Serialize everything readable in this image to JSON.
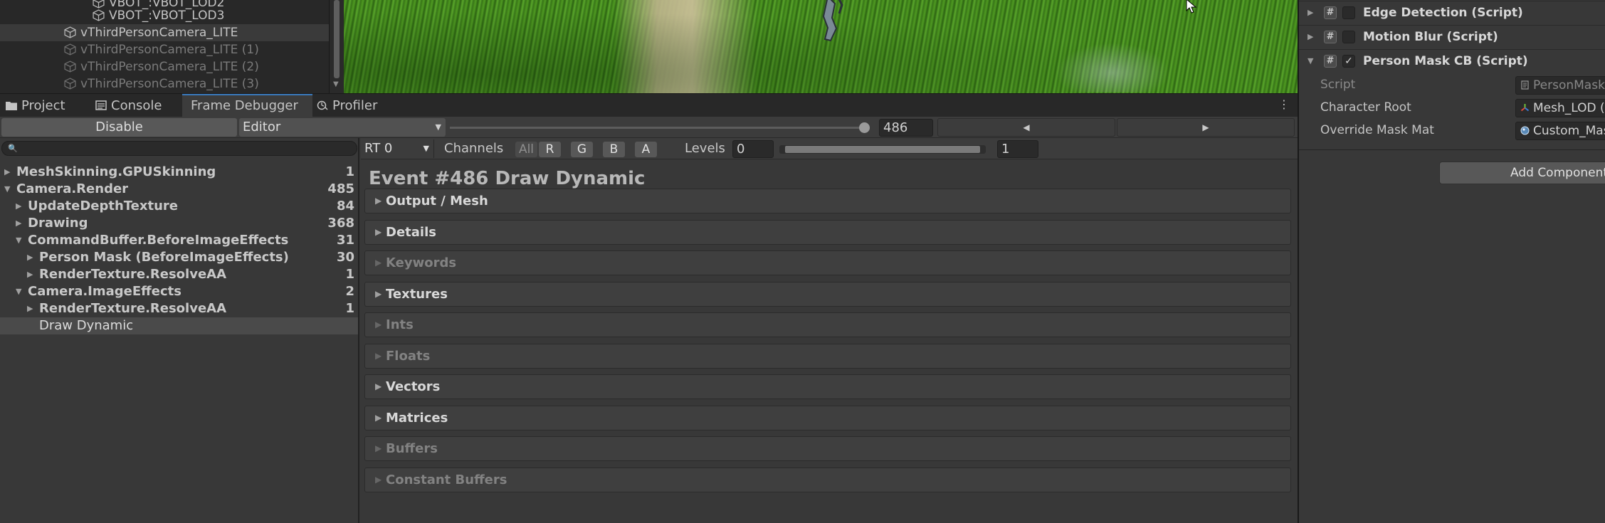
{
  "hierarchy": {
    "items": [
      {
        "label": "VBOT_:VBOT_LOD2",
        "dim": false
      },
      {
        "label": "VBOT_:VBOT_LOD3",
        "dim": false
      },
      {
        "label": "vThirdPersonCamera_LITE",
        "dim": false,
        "selected": true
      },
      {
        "label": "vThirdPersonCamera_LITE (1)",
        "dim": true
      },
      {
        "label": "vThirdPersonCamera_LITE (2)",
        "dim": true
      },
      {
        "label": "vThirdPersonCamera_LITE (3)",
        "dim": true
      }
    ]
  },
  "tabs": [
    {
      "label": "Project",
      "icon": "folder-icon"
    },
    {
      "label": "Console",
      "icon": "console-icon"
    },
    {
      "label": "Frame Debugger",
      "icon": "",
      "active": true
    },
    {
      "label": "Profiler",
      "icon": "profiler-icon"
    }
  ],
  "toolbar": {
    "disable_label": "Disable",
    "target": "Editor",
    "event_value": "486",
    "event_fraction": 1.0
  },
  "tree": {
    "items": [
      {
        "label": "MeshSkinning.GPUSkinning",
        "count": "1",
        "depth": 0,
        "fold": "closed",
        "bold": true
      },
      {
        "label": "Camera.Render",
        "count": "485",
        "depth": 0,
        "fold": "open",
        "bold": true
      },
      {
        "label": "UpdateDepthTexture",
        "count": "84",
        "depth": 1,
        "fold": "closed",
        "bold": true
      },
      {
        "label": "Drawing",
        "count": "368",
        "depth": 1,
        "fold": "closed",
        "bold": true
      },
      {
        "label": "CommandBuffer.BeforeImageEffects",
        "count": "31",
        "depth": 1,
        "fold": "open",
        "bold": true
      },
      {
        "label": "Person Mask (BeforeImageEffects)",
        "count": "30",
        "depth": 2,
        "fold": "closed",
        "bold": true
      },
      {
        "label": "RenderTexture.ResolveAA",
        "count": "1",
        "depth": 2,
        "fold": "closed",
        "bold": true
      },
      {
        "label": "Camera.ImageEffects",
        "count": "2",
        "depth": 1,
        "fold": "open",
        "bold": true
      },
      {
        "label": "RenderTexture.ResolveAA",
        "count": "1",
        "depth": 2,
        "fold": "closed",
        "bold": true
      },
      {
        "label": "Draw Dynamic",
        "count": "",
        "depth": 2,
        "fold": "none",
        "bold": false,
        "selected": true
      }
    ]
  },
  "details": {
    "rt_label": "RT 0",
    "channels_label": "Channels",
    "channels": [
      "All",
      "R",
      "G",
      "B",
      "A"
    ],
    "levels_label": "Levels",
    "levels_min": "0",
    "levels_max": "1",
    "event_title": "Event #486 Draw Dynamic",
    "sections": [
      {
        "label": "Output / Mesh",
        "enabled": true
      },
      {
        "label": "Details",
        "enabled": true
      },
      {
        "label": "Keywords",
        "enabled": false
      },
      {
        "label": "Textures",
        "enabled": true
      },
      {
        "label": "Ints",
        "enabled": false
      },
      {
        "label": "Floats",
        "enabled": false
      },
      {
        "label": "Vectors",
        "enabled": true
      },
      {
        "label": "Matrices",
        "enabled": true
      },
      {
        "label": "Buffers",
        "enabled": false
      },
      {
        "label": "Constant Buffers",
        "enabled": false
      }
    ]
  },
  "inspector": {
    "components": [
      {
        "label": "Edge Detection (Script)",
        "enabled": false,
        "expanded": false
      },
      {
        "label": "Motion Blur (Script)",
        "enabled": false,
        "expanded": false
      },
      {
        "label": "Person Mask CB (Script)",
        "enabled": true,
        "expanded": true
      }
    ],
    "properties": [
      {
        "label": "Script",
        "value": "PersonMask",
        "icon": "script-icon",
        "dim": true
      },
      {
        "label": "Character Root",
        "value": "Mesh_LOD (",
        "icon": "transform-icon",
        "dim": false
      },
      {
        "label": "Override Mask Mat",
        "value": "Custom_Mas",
        "icon": "material-icon",
        "dim": false
      }
    ],
    "add_component_label": "Add Component"
  },
  "colors": {
    "accent": "#3a79bb",
    "panel_bg": "#383838",
    "grass": "#4f9a22"
  }
}
